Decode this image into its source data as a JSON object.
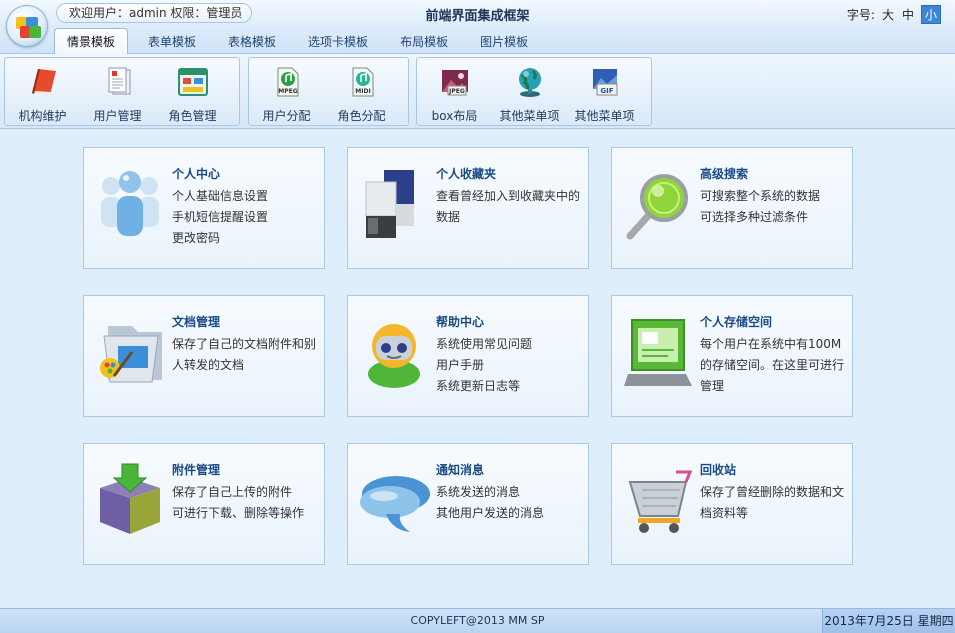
{
  "header": {
    "welcome": "欢迎用户：admin 权限：管理员",
    "title": "前端界面集成框架",
    "fontsize_label": "字号:",
    "fontsize_options": [
      "大",
      "中",
      "小"
    ],
    "fontsize_selected": "小"
  },
  "tabs": [
    {
      "label": "情景模板",
      "active": true
    },
    {
      "label": "表单模板",
      "active": false
    },
    {
      "label": "表格模板",
      "active": false
    },
    {
      "label": "选项卡模板",
      "active": false
    },
    {
      "label": "布局模板",
      "active": false
    },
    {
      "label": "图片模板",
      "active": false
    }
  ],
  "toolbar": {
    "groups": [
      {
        "buttons": [
          {
            "label": "机构维护",
            "icon": "book-icon"
          },
          {
            "label": "用户管理",
            "icon": "document-icon"
          },
          {
            "label": "角色管理",
            "icon": "window-icon"
          }
        ]
      },
      {
        "buttons": [
          {
            "label": "用户分配",
            "icon": "mpeg-file-icon"
          },
          {
            "label": "角色分配",
            "icon": "midi-file-icon"
          }
        ]
      },
      {
        "buttons": [
          {
            "label": "box布局",
            "icon": "jpeg-file-icon"
          },
          {
            "label": "其他菜单项",
            "icon": "globe-icon"
          },
          {
            "label": "其他菜单项",
            "icon": "gif-file-icon"
          }
        ]
      }
    ],
    "icon_text": {
      "mpeg": "MPEG",
      "midi": "MIDI",
      "jpeg": "JPEG",
      "gif": "GIF"
    }
  },
  "cards": [
    {
      "title": "个人中心",
      "lines": [
        "个人基础信息设置",
        "手机短信提醒设置",
        "更改密码"
      ],
      "icon": "users-icon"
    },
    {
      "title": "个人收藏夹",
      "lines": [
        "查看曾经加入到收藏夹中的",
        "数据"
      ],
      "icon": "favorites-icon"
    },
    {
      "title": "高级搜索",
      "lines": [
        "可搜索整个系统的数据",
        "可选择多种过滤条件"
      ],
      "icon": "magnifier-icon"
    },
    {
      "title": "文档管理",
      "lines": [
        "保存了自己的文档附件和别",
        "人转发的文档"
      ],
      "icon": "folder-icon"
    },
    {
      "title": "帮助中心",
      "lines": [
        "系统使用常见问题",
        "用户手册",
        "系统更新日志等"
      ],
      "icon": "helper-robot-icon"
    },
    {
      "title": "个人存储空间",
      "lines": [
        "每个用户在系统中有100M",
        "的存储空间。在这里可进行",
        "管理"
      ],
      "icon": "monitor-icon"
    },
    {
      "title": "附件管理",
      "lines": [
        "保存了自己上传的附件",
        "可进行下载、删除等操作"
      ],
      "icon": "upload-box-icon"
    },
    {
      "title": "通知消息",
      "lines": [
        "系统发送的消息",
        "其他用户发送的消息"
      ],
      "icon": "message-cloud-icon"
    },
    {
      "title": "回收站",
      "lines": [
        "保存了曾经删除的数据和文",
        "档资料等"
      ],
      "icon": "cart-icon"
    }
  ],
  "footer": {
    "copyright": "COPYLEFT@2013 MM SP",
    "date": "2013年7月25日 星期四"
  },
  "colors": {
    "accent": "#3d85d6",
    "background": "#dfeefb",
    "card_title": "#1a4b86"
  }
}
